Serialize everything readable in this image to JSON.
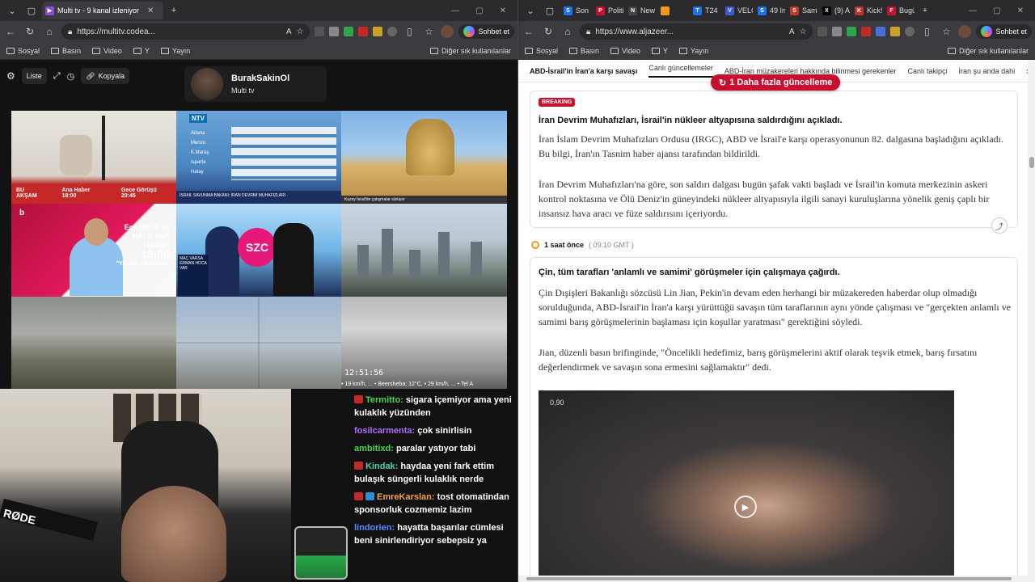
{
  "left": {
    "tab": {
      "title": "Multi tv - 9 kanal izleniyor"
    },
    "address": "https://multitv.codea...",
    "copilot": "Sohbet et",
    "bookmarks": [
      "Sosyal",
      "Basın",
      "Video",
      "Y",
      "Yayın"
    ],
    "bookmarks_right": "Diğer sık kullanılanlar",
    "toolbar": {
      "list": "Liste",
      "copy": "Kopyala"
    },
    "channel": {
      "name": "BurakSakinOl",
      "subtitle": "Multi tv"
    },
    "tiles": {
      "t1_bar": [
        "BU AKŞAM",
        "Ana Haber 18:00",
        "Gece Görüşü 20:45"
      ],
      "t2_logo": "NTV",
      "t2_cities": [
        "Adana",
        "Mersin",
        "K.Maraş",
        "Isparta",
        "Hatay"
      ],
      "t2_foot": "İsrail Savunma Bakanı: İran Devrim Muhafızları",
      "t3_foot": "Kuzey İsrail'de çatışmalar sürüyor",
      "t4_brand": "b",
      "t4_line1": "Ece ÜNER ile",
      "t4_line2": "HALK ANA HABER",
      "t4_time": "18:00",
      "t4_line3": "\"YALNIZ DEĞİLSİN\"",
      "t5_logo": "SZC",
      "t5_lower": "MAÇ VARSA ERMAN HOCA VAR",
      "t9_time": "12:51:56",
      "t9_ticker": "• 19 km/h, ... • Beersheba: 12°C, • 29 km/h, ... • Tel A"
    },
    "chat": [
      {
        "user": "Termitto",
        "color": "#4fd34f",
        "text": "sigara içemiyor ama yeni kulaklık yüzünden",
        "badge": "red"
      },
      {
        "user": "fosilcarmenta",
        "color": "#b36bff",
        "text": "çok sinirlisin",
        "badge": ""
      },
      {
        "user": "ambitixd",
        "color": "#4fd34f",
        "text": "paralar yatıyor tabi",
        "badge": ""
      },
      {
        "user": "Kindak",
        "color": "#4fd3b4",
        "text": "haydaa yeni fark ettim bulaşık süngerli kulaklık nerde",
        "badge": "red"
      },
      {
        "user": "EmreKarslan",
        "color": "#f0a050",
        "text": "tost otomatindan sponsorluk cozmemiz lazim",
        "badge": "both"
      },
      {
        "user": "lindorien",
        "color": "#5a8cff",
        "text": "hayatta başarılar cümlesi beni sinirlendiriyor sebepsiz ya",
        "badge": ""
      }
    ],
    "cam_label": "RØDE"
  },
  "right": {
    "tabs": [
      {
        "label": "Son",
        "fav_color": "#1a73e8",
        "fav": "S"
      },
      {
        "label": "Politi",
        "fav_color": "#c8102e",
        "fav": "P"
      },
      {
        "label": "New",
        "fav_color": "#444",
        "fav": "N"
      },
      {
        "label": "",
        "fav_color": "#f29b1a",
        "fav": ""
      },
      {
        "label": "T24",
        "fav_color": "#1a73e8",
        "fav": "T"
      },
      {
        "label": "VELC",
        "fav_color": "#3b5bdb",
        "fav": "V"
      },
      {
        "label": "49 In",
        "fav_color": "#1a73e8",
        "fav": "S"
      },
      {
        "label": "Sam",
        "fav_color": "#c0392b",
        "fav": "S"
      },
      {
        "label": "(9) A",
        "fav_color": "#000",
        "fav": "X"
      },
      {
        "label": "Kick!",
        "fav_color": "#b33",
        "fav": "K"
      },
      {
        "label": "Bugü",
        "fav_color": "#c8102e",
        "fav": "F"
      }
    ],
    "address": "https://www.aljazeer...",
    "copilot": "Sohbet et",
    "bookmarks": [
      "Sosyal",
      "Basın",
      "Video",
      "Y",
      "Yayın"
    ],
    "bookmarks_right": "Diğer sık kullanılanlar",
    "nav": [
      "ABD-İsrail'in İran'a karşı savaşı",
      "Canlı güncellemeler",
      "ABD-İran müzakereleri hakkında bilinmesi gerekenler",
      "Canlı takipçi",
      "İran şu anda dahi"
    ],
    "update_pill": "1 Daha fazla güncelleme",
    "card1": {
      "breaking": "BREAKING",
      "title": "İran Devrim Muhafızları, İsrail'in nükleer altyapısına saldırdığını açıkladı.",
      "p1": "İran İslam Devrim Muhafızları Ordusu (IRGC), ABD ve İsrail'e karşı operasyonunun 82. dalgasına başladığını açıkladı. Bu bilgi, İran'ın Tasnim haber ajansı tarafından bildirildi.",
      "p2": "İran Devrim Muhafızları'na göre, son saldırı dalgası bugün şafak vakti başladı ve İsrail'in komuta merkezinin askeri kontrol noktasına ve Ölü Deniz'in güneyindeki nükleer altyapısıyla ilgili sanayi kuruluşlarına yönelik geniş çaplı bir insansız hava aracı ve füze saldırısını içeriyordu."
    },
    "timeline": {
      "ago": "1 saat önce",
      "gmt": "( 09:10 GMT )"
    },
    "card2": {
      "title": "Çin, tüm tarafları 'anlamlı ve samimi' görüşmeler için çalışmaya çağırdı.",
      "p1": "Çin Dışişleri Bakanlığı sözcüsü Lin Jian, Pekin'in devam eden herhangi bir müzakereden haberdar olup olmadığı sorulduğunda, ABD-İsrail'in İran'a karşı yürüttüğü savaşın tüm taraflarının aynı yönde çalışması ve \"gerçekten anlamlı ve samimi barış görüşmelerinin başlaması için koşullar yaratması\" gerektiğini söyledi.",
      "p2": "Jian, düzenli basın brifinginde, \"Öncelikli hedefimiz, barış görüşmelerini aktif olarak teşvik etmek, barış fırsatını değerlendirmek ve savaşın sona ermesini sağlamaktır\" dedi.",
      "video_zoom": "0,90"
    }
  }
}
